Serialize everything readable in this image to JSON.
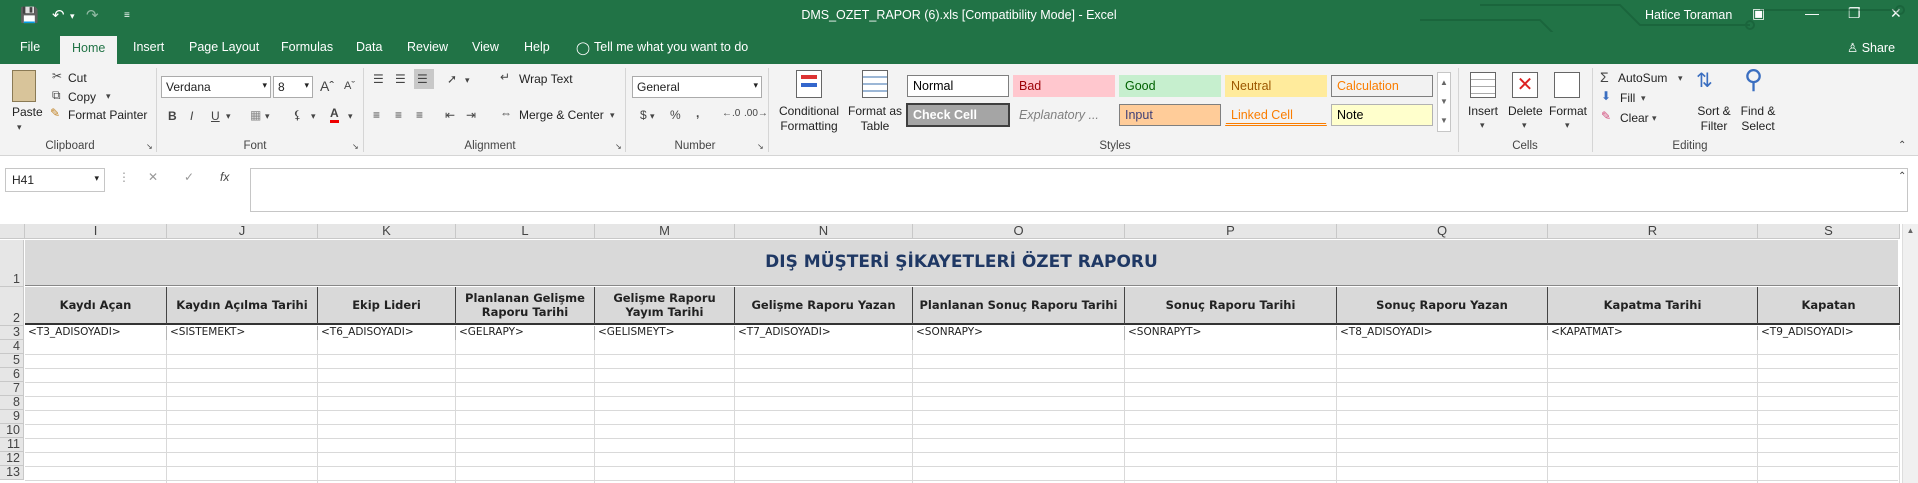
{
  "window": {
    "title": "DMS_OZET_RAPOR (6).xls  [Compatibility Mode]  -  Excel",
    "user": "Hatice Toraman"
  },
  "tabs": [
    "File",
    "Home",
    "Insert",
    "Page Layout",
    "Formulas",
    "Data",
    "Review",
    "View",
    "Help"
  ],
  "tell_me": "Tell me what you want to do",
  "share": "Share",
  "clipboard": {
    "paste": "Paste",
    "cut": "Cut",
    "copy": "Copy",
    "format_painter": "Format Painter",
    "label": "Clipboard"
  },
  "font": {
    "name": "Verdana",
    "size": "8",
    "label": "Font",
    "bold": "B",
    "italic": "I",
    "underline": "U"
  },
  "alignment": {
    "wrap": "Wrap Text",
    "merge": "Merge & Center",
    "label": "Alignment"
  },
  "number": {
    "format": "General",
    "label": "Number",
    "currency": "$",
    "percent": "%",
    "comma": ","
  },
  "styles": {
    "conditional": "Conditional Formatting",
    "format_table": "Format as Table",
    "label": "Styles",
    "cells": [
      {
        "name": "Normal",
        "bg": "#ffffff",
        "fg": "#000000",
        "border": "#7f7f7f"
      },
      {
        "name": "Bad",
        "bg": "#ffc7ce",
        "fg": "#9c0006",
        "border": "#ffc7ce"
      },
      {
        "name": "Good",
        "bg": "#c6efce",
        "fg": "#006100",
        "border": "#c6efce"
      },
      {
        "name": "Neutral",
        "bg": "#ffeb9c",
        "fg": "#9c5700",
        "border": "#ffeb9c"
      },
      {
        "name": "Calculation",
        "bg": "#f2f2f2",
        "fg": "#fa7d00",
        "border": "#7f7f7f"
      },
      {
        "name": "Check Cell",
        "bg": "#a5a5a5",
        "fg": "#ffffff",
        "border": "#3f3f3f"
      },
      {
        "name": "Explanatory ...",
        "bg": "#f3f3f3",
        "fg": "#7f7f7f",
        "border": "#f3f3f3"
      },
      {
        "name": "Input",
        "bg": "#ffcc99",
        "fg": "#3f3f76",
        "border": "#7f7f7f"
      },
      {
        "name": "Linked Cell",
        "bg": "#f3f3f3",
        "fg": "#fa7d00",
        "border": "#f3f3f3"
      },
      {
        "name": "Note",
        "bg": "#ffffcc",
        "fg": "#000000",
        "border": "#b2b2b2"
      }
    ]
  },
  "cells_group": {
    "insert": "Insert",
    "delete": "Delete",
    "format": "Format",
    "label": "Cells"
  },
  "editing": {
    "autosum": "AutoSum",
    "fill": "Fill",
    "clear": "Clear",
    "sort": "Sort & Filter",
    "find": "Find & Select",
    "label": "Editing"
  },
  "formula_bar": {
    "name_box": "H41",
    "fx": "fx",
    "value": ""
  },
  "columns": [
    "I",
    "J",
    "K",
    "L",
    "M",
    "N",
    "O",
    "P",
    "Q",
    "R",
    "S"
  ],
  "rows": [
    "1",
    "2",
    "3",
    "4",
    "5",
    "6",
    "7",
    "8",
    "9",
    "10",
    "11",
    "12",
    "13"
  ],
  "sheet": {
    "title": "DIŞ MÜŞTERİ ŞİKAYETLERİ ÖZET RAPORU",
    "headers": [
      "Kaydı Açan",
      "Kaydın Açılma Tarihi",
      "Ekip Lideri",
      "Planlanan Gelişme Raporu Tarihi",
      "Gelişme Raporu Yayım Tarihi",
      "Gelişme Raporu Yazan",
      "Planlanan Sonuç Raporu Tarihi",
      "Sonuç Raporu Tarihi",
      "Sonuç Raporu Yazan",
      "Kapatma Tarihi",
      "Kapatan"
    ],
    "row3": [
      "<T3_ADISOYADI>",
      "<SISTEMEKT>",
      "<T6_ADISOYADI>",
      "<GELRAPY>",
      "<GELISMEYT>",
      "<T7_ADISOYADI>",
      "<SONRAPY>",
      "<SONRAPYT>",
      "<T8_ADISOYADI>",
      "<KAPATMAT>",
      "<T9_ADISOYADI>"
    ]
  }
}
